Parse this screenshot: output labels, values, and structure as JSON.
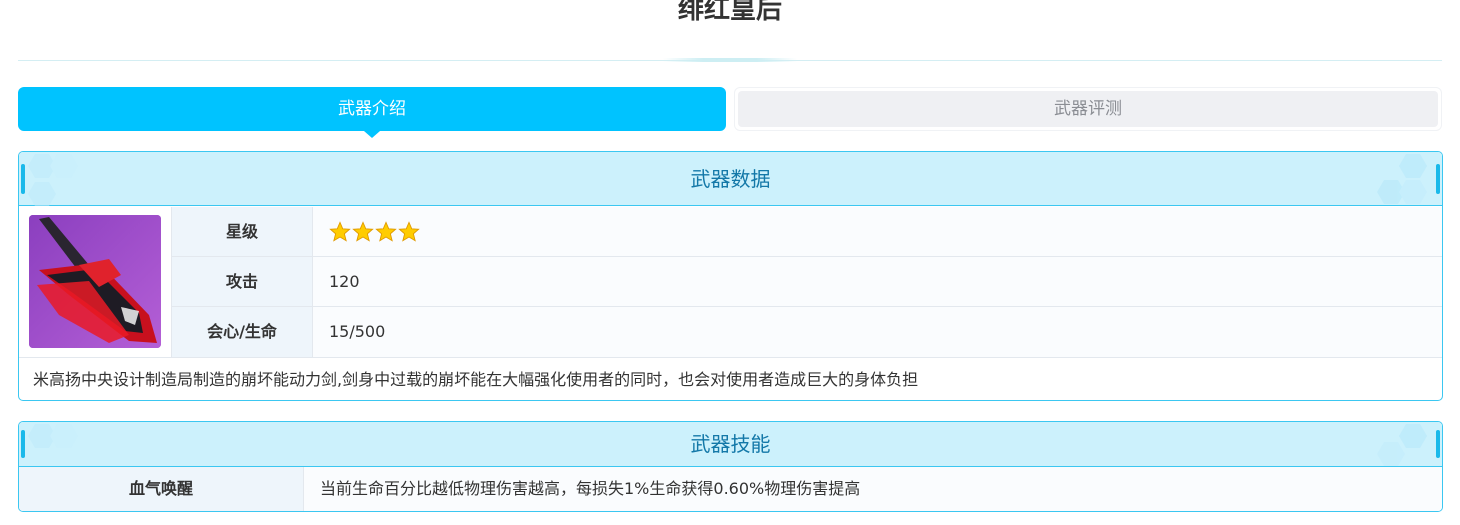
{
  "page": {
    "title": "绯红皇后"
  },
  "tabs": [
    {
      "label": "武器介绍",
      "active": true
    },
    {
      "label": "武器评测",
      "active": false
    }
  ],
  "weapon_data": {
    "header": "武器数据",
    "image_icon": "weapon-sword-image",
    "stats": [
      {
        "label": "星级",
        "value": "",
        "stars": 4
      },
      {
        "label": "攻击",
        "value": "120"
      },
      {
        "label": "会心/生命",
        "value": "15/500"
      }
    ],
    "description": "米高扬中央设计制造局制造的崩坏能动力剑,剑身中过载的崩坏能在大幅强化使用者的同时，也会对使用者造成巨大的身体负担"
  },
  "weapon_skill": {
    "header": "武器技能",
    "skills": [
      {
        "name": "血气唤醒",
        "description": "当前生命百分比越低物理伤害越高，每损失1%生命获得0.60%物理伤害提高"
      }
    ]
  },
  "colors": {
    "accent": "#00c3ff",
    "panel_border": "#3bc7f1",
    "panel_header_bg": "#ccf1fc",
    "panel_header_text": "#1378a8",
    "star": "#ffcc00"
  }
}
